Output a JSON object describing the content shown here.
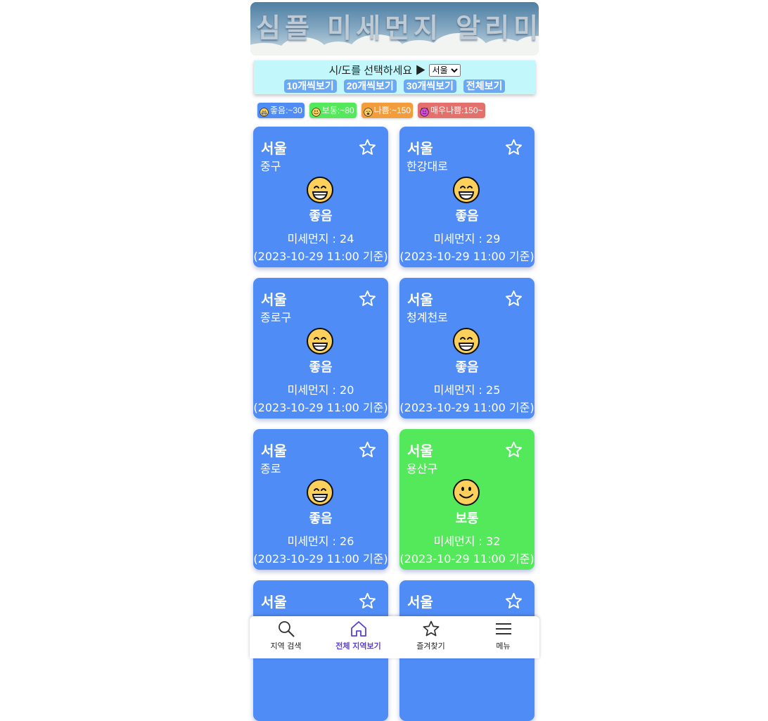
{
  "banner": {
    "title": "심플 미세먼지 알리미"
  },
  "selector": {
    "prompt": "시/도를 선택하세요 ▶",
    "selected": "서울",
    "options": [
      "서울"
    ]
  },
  "view_buttons": [
    "10개씩보기",
    "20개씩보기",
    "30개씩보기",
    "전체보기"
  ],
  "legend": [
    {
      "label": "좋음:~30",
      "color": "#4f8cf6",
      "face": "grin"
    },
    {
      "label": "보통:~80",
      "color": "#54e85b",
      "face": "smile"
    },
    {
      "label": "나쁨:~150",
      "color": "#f39c3c",
      "face": "cry"
    },
    {
      "label": "매우나쁨:150~",
      "color": "#e4706c",
      "face": "devil"
    }
  ],
  "cards": [
    {
      "city": "서울",
      "district": "중구",
      "status": "좋음",
      "pm": "미세먼지 : 24",
      "time": "(2023-10-29 11:00 기준)",
      "color": "#4f8cf6",
      "face": "grin"
    },
    {
      "city": "서울",
      "district": "한강대로",
      "status": "좋음",
      "pm": "미세먼지 : 29",
      "time": "(2023-10-29 11:00 기준)",
      "color": "#4f8cf6",
      "face": "grin"
    },
    {
      "city": "서울",
      "district": "종로구",
      "status": "좋음",
      "pm": "미세먼지 : 20",
      "time": "(2023-10-29 11:00 기준)",
      "color": "#4f8cf6",
      "face": "grin"
    },
    {
      "city": "서울",
      "district": "청계천로",
      "status": "좋음",
      "pm": "미세먼지 : 25",
      "time": "(2023-10-29 11:00 기준)",
      "color": "#4f8cf6",
      "face": "grin"
    },
    {
      "city": "서울",
      "district": "종로",
      "status": "좋음",
      "pm": "미세먼지 : 26",
      "time": "(2023-10-29 11:00 기준)",
      "color": "#4f8cf6",
      "face": "grin"
    },
    {
      "city": "서울",
      "district": "용산구",
      "status": "보통",
      "pm": "미세먼지 : 32",
      "time": "(2023-10-29 11:00 기준)",
      "color": "#54e85b",
      "face": "smile"
    },
    {
      "city": "서울",
      "district": "",
      "status": "",
      "pm": "",
      "time": "",
      "color": "#4f8cf6",
      "face": "grin"
    },
    {
      "city": "서울",
      "district": "",
      "status": "",
      "pm": "",
      "time": "",
      "color": "#4f8cf6",
      "face": "grin"
    }
  ],
  "nav": {
    "items": [
      {
        "label": "지역 검색",
        "icon": "search-icon"
      },
      {
        "label": "전체 지역보기",
        "icon": "home-icon",
        "active": true
      },
      {
        "label": "즐겨찾기",
        "icon": "star-icon"
      },
      {
        "label": "메뉴",
        "icon": "menu-icon"
      }
    ]
  }
}
